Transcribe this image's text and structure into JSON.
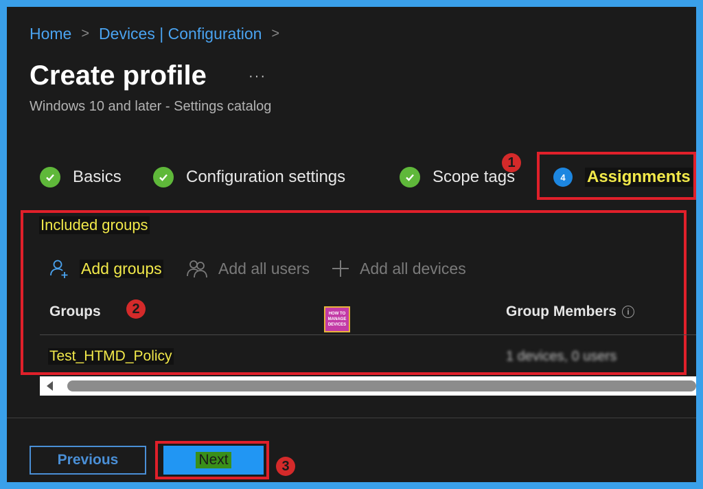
{
  "breadcrumb": {
    "items": [
      "Home",
      "Devices | Configuration"
    ],
    "separator": ">"
  },
  "header": {
    "title": "Create profile",
    "more": "···",
    "subtitle": "Windows 10 and later - Settings catalog"
  },
  "steps": [
    {
      "label": "Basics",
      "state": "done"
    },
    {
      "label": "Configuration settings",
      "state": "done"
    },
    {
      "label": "Scope tags",
      "state": "done"
    },
    {
      "label": "Assignments",
      "state": "active",
      "number": "4"
    }
  ],
  "annotations": {
    "badge1": "1",
    "badge2": "2",
    "badge3": "3"
  },
  "included_groups": {
    "heading": "Included groups",
    "actions": [
      {
        "label": "Add groups",
        "icon": "add-user-icon",
        "enabled": true
      },
      {
        "label": "Add all users",
        "icon": "users-icon",
        "enabled": false
      },
      {
        "label": "Add all devices",
        "icon": "plus-icon",
        "enabled": false
      }
    ],
    "columns": [
      "Groups",
      "Group Members"
    ],
    "info_icon": "i",
    "rows": [
      {
        "group": "Test_HTMD_Policy",
        "members": "1 devices, 0 users"
      }
    ]
  },
  "logo": {
    "lines": [
      "HOW TO",
      "MANAGE",
      "DEVICES"
    ]
  },
  "footer": {
    "previous_label": "Previous",
    "next_label": "Next"
  },
  "colors": {
    "accent": "#2196f3",
    "highlight": "#f2e94a",
    "annotation_red": "#e0202a",
    "check_green": "#5fb83a"
  }
}
